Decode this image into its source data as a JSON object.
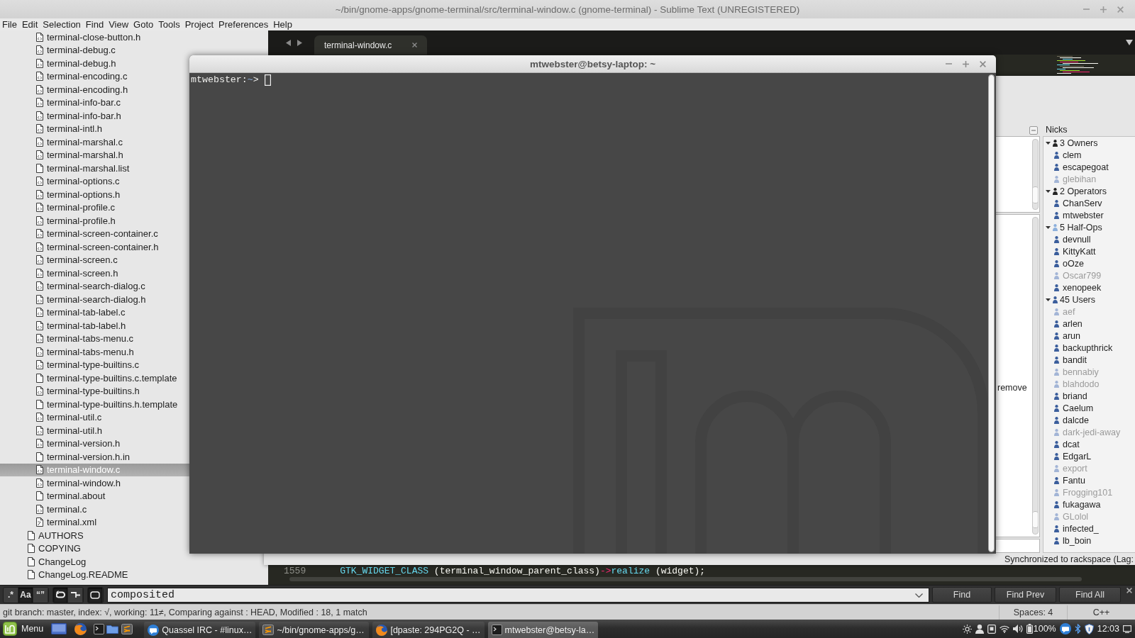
{
  "window": {
    "title": "~/bin/gnome-apps/gnome-terminal/src/terminal-window.c (gnome-terminal) - Sublime Text (UNREGISTERED)"
  },
  "menu": [
    "File",
    "Edit",
    "Selection",
    "Find",
    "View",
    "Goto",
    "Tools",
    "Project",
    "Preferences",
    "Help"
  ],
  "sidebar": {
    "items": [
      {
        "children": [
          {
            "label": "terminal-close-button.h",
            "kind": "source",
            "selected": false
          },
          {
            "label": "terminal-debug.c",
            "kind": "source",
            "selected": false
          },
          {
            "label": "terminal-debug.h",
            "kind": "source",
            "selected": false
          },
          {
            "label": "terminal-encoding.c",
            "kind": "source",
            "selected": false
          },
          {
            "label": "terminal-encoding.h",
            "kind": "source",
            "selected": false
          },
          {
            "label": "terminal-info-bar.c",
            "kind": "source",
            "selected": false
          },
          {
            "label": "terminal-info-bar.h",
            "kind": "source",
            "selected": false
          },
          {
            "label": "terminal-intl.h",
            "kind": "source",
            "selected": false
          },
          {
            "label": "terminal-marshal.c",
            "kind": "source",
            "selected": false
          },
          {
            "label": "terminal-marshal.h",
            "kind": "source",
            "selected": false
          },
          {
            "label": "terminal-marshal.list",
            "kind": "plain",
            "selected": false
          },
          {
            "label": "terminal-options.c",
            "kind": "source",
            "selected": false
          },
          {
            "label": "terminal-options.h",
            "kind": "source",
            "selected": false
          },
          {
            "label": "terminal-profile.c",
            "kind": "source",
            "selected": false
          },
          {
            "label": "terminal-profile.h",
            "kind": "source",
            "selected": false
          },
          {
            "label": "terminal-screen-container.c",
            "kind": "source",
            "selected": false
          },
          {
            "label": "terminal-screen-container.h",
            "kind": "source",
            "selected": false
          },
          {
            "label": "terminal-screen.c",
            "kind": "source",
            "selected": false
          },
          {
            "label": "terminal-screen.h",
            "kind": "source",
            "selected": false
          },
          {
            "label": "terminal-search-dialog.c",
            "kind": "source",
            "selected": false
          },
          {
            "label": "terminal-search-dialog.h",
            "kind": "source",
            "selected": false
          },
          {
            "label": "terminal-tab-label.c",
            "kind": "source",
            "selected": false
          },
          {
            "label": "terminal-tab-label.h",
            "kind": "source",
            "selected": false
          },
          {
            "label": "terminal-tabs-menu.c",
            "kind": "source",
            "selected": false
          },
          {
            "label": "terminal-tabs-menu.h",
            "kind": "source",
            "selected": false
          },
          {
            "label": "terminal-type-builtins.c",
            "kind": "source",
            "selected": false
          },
          {
            "label": "terminal-type-builtins.c.template",
            "kind": "plain",
            "selected": false
          },
          {
            "label": "terminal-type-builtins.h",
            "kind": "source",
            "selected": false
          },
          {
            "label": "terminal-type-builtins.h.template",
            "kind": "plain",
            "selected": false
          },
          {
            "label": "terminal-util.c",
            "kind": "source",
            "selected": false
          },
          {
            "label": "terminal-util.h",
            "kind": "source",
            "selected": false
          },
          {
            "label": "terminal-version.h",
            "kind": "source",
            "selected": false
          },
          {
            "label": "terminal-version.h.in",
            "kind": "plain",
            "selected": false
          },
          {
            "label": "terminal-window.c",
            "kind": "source",
            "selected": true
          },
          {
            "label": "terminal-window.h",
            "kind": "source",
            "selected": false
          },
          {
            "label": "terminal.about",
            "kind": "plain",
            "selected": false
          },
          {
            "label": "terminal.c",
            "kind": "source",
            "selected": false
          },
          {
            "label": "terminal.xml",
            "kind": "xml",
            "selected": false
          }
        ]
      },
      {
        "label": "AUTHORS",
        "kind": "plain",
        "selected": false
      },
      {
        "label": "COPYING",
        "kind": "plain",
        "selected": false
      },
      {
        "label": "ChangeLog",
        "kind": "plain",
        "selected": false
      },
      {
        "label": "ChangeLog.README",
        "kind": "plain",
        "selected": false
      }
    ]
  },
  "editor": {
    "tabs": [
      {
        "label": "terminal-window.c",
        "selected": true
      }
    ],
    "code_line": {
      "number": "1559",
      "tokens": [
        {
          "text": "GTK_WIDGET_CLASS",
          "kind": "function"
        },
        {
          "text": " (terminal_window_parent_class)",
          "kind": "plain"
        },
        {
          "text": "->",
          "kind": "operator"
        },
        {
          "text": "realize",
          "kind": "function"
        },
        {
          "text": " (widget);",
          "kind": "plain"
        }
      ]
    }
  },
  "terminal": {
    "title": "mtwebster@betsy-laptop: ~",
    "prompt": {
      "user": "mtwebster:",
      "path": "~",
      "symbol": ">"
    }
  },
  "irc": {
    "chat_text": "remove",
    "nicks": {
      "title": "Nicks",
      "groups": [
        {
          "label": "3 Owners",
          "kind": "owner",
          "expanded": true,
          "children": [
            {
              "nick": "clem",
              "away": false
            },
            {
              "nick": "escapegoat",
              "away": false
            },
            {
              "nick": "glebihan",
              "away": true
            }
          ]
        },
        {
          "label": "2 Operators",
          "kind": "operator",
          "expanded": true,
          "children": [
            {
              "nick": "ChanServ",
              "away": false
            },
            {
              "nick": "mtwebster",
              "away": false
            }
          ]
        },
        {
          "label": "5 Half-Ops",
          "kind": "half-op",
          "expanded": true,
          "children": [
            {
              "nick": "devnull",
              "away": false
            },
            {
              "nick": "KittyKatt",
              "away": false
            },
            {
              "nick": "oOze",
              "away": false
            },
            {
              "nick": "Oscar799",
              "away": true
            },
            {
              "nick": "xenopeek",
              "away": false
            }
          ]
        },
        {
          "label": "45 Users",
          "kind": "user",
          "expanded": true,
          "children": [
            {
              "nick": "aef",
              "away": true
            },
            {
              "nick": "arlen",
              "away": false
            },
            {
              "nick": "arun",
              "away": false
            },
            {
              "nick": "backupthrick",
              "away": false
            },
            {
              "nick": "bandit",
              "away": false
            },
            {
              "nick": "bennabiy",
              "away": true
            },
            {
              "nick": "blahdodo",
              "away": true
            },
            {
              "nick": "briand",
              "away": false
            },
            {
              "nick": "Caelum",
              "away": false
            },
            {
              "nick": "dalcde",
              "away": false
            },
            {
              "nick": "dark-jedi-away",
              "away": true
            },
            {
              "nick": "dcat",
              "away": false
            },
            {
              "nick": "EdgarL",
              "away": false
            },
            {
              "nick": "export",
              "away": true
            },
            {
              "nick": "Fantu",
              "away": false
            },
            {
              "nick": "Frogging101",
              "away": true
            },
            {
              "nick": "fukagawa",
              "away": false
            },
            {
              "nick": "GLolol",
              "away": true
            },
            {
              "nick": "infected_",
              "away": false
            },
            {
              "nick": "lb_boin",
              "away": false
            }
          ]
        }
      ]
    },
    "status": "Synchronized to rackspace (Lag:"
  },
  "find_panel": {
    "toggles": [
      {
        "kind": "regex",
        "label": ".*",
        "on": false
      },
      {
        "kind": "case",
        "label": "Aa",
        "on": true
      },
      {
        "kind": "whole-word",
        "label": "“”",
        "on": false
      },
      {
        "kind": "wrap",
        "on": true
      },
      {
        "kind": "in-selection",
        "on": false
      },
      {
        "kind": "highlight",
        "on": true
      }
    ],
    "query": "composited",
    "buttons": [
      "Find",
      "Find Prev",
      "Find All"
    ]
  },
  "status_bar": {
    "git": "git branch: master, index: √, working: 11≠, Comparing against : HEAD, Modified : 18, 1 match",
    "indentation": "Spaces: 4",
    "syntax": "C++"
  },
  "taskbar": {
    "menu_label": "Menu",
    "windows": [
      {
        "label": "Quassel IRC - #linux…",
        "kind": "chat",
        "selected": false
      },
      {
        "label": "~/bin/gnome-apps/g…",
        "kind": "editor",
        "selected": false
      },
      {
        "label": "[dpaste: 294PG2Q - …",
        "kind": "browser",
        "selected": false
      },
      {
        "label": "mtwebster@betsy-la…",
        "kind": "terminal",
        "selected": true
      }
    ],
    "battery": "100%",
    "clock": "12:03"
  }
}
